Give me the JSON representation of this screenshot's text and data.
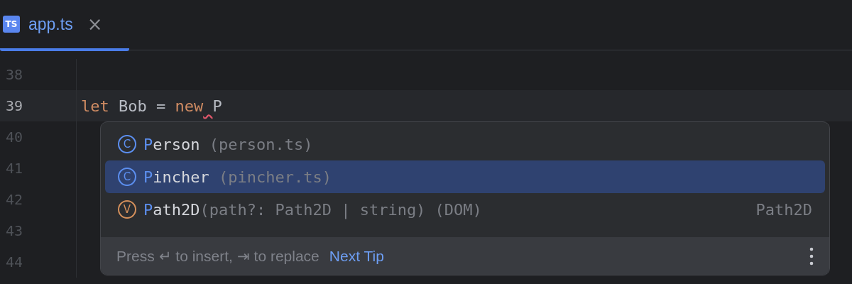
{
  "tabs": [
    {
      "label": "app.ts",
      "icon_text": "TS",
      "selected": true,
      "close": "×"
    }
  ],
  "editor": {
    "lines": [
      {
        "number": "38",
        "current": false
      },
      {
        "number": "39",
        "current": true,
        "tokens": [
          {
            "kind": "keyword",
            "text": "let"
          },
          {
            "kind": "plain",
            "text": " Bob = "
          },
          {
            "kind": "keyword",
            "text": "new"
          },
          {
            "kind": "plain",
            "text": " P",
            "error_lead": true
          }
        ]
      },
      {
        "number": "40",
        "current": false
      },
      {
        "number": "41",
        "current": false
      },
      {
        "number": "42",
        "current": false
      },
      {
        "number": "43",
        "current": false
      },
      {
        "number": "44",
        "current": false
      }
    ]
  },
  "completion": {
    "items": [
      {
        "kind": "class",
        "badge": "C",
        "match": "P",
        "rest": "erson",
        "detail": " (person.ts)",
        "selected": false
      },
      {
        "kind": "class",
        "badge": "C",
        "match": "P",
        "rest": "incher",
        "detail": " (pincher.ts)",
        "selected": true
      },
      {
        "kind": "variable",
        "badge": "V",
        "match": "P",
        "rest": "ath2D",
        "detail": "(path?: Path2D | string) (DOM)",
        "type": "Path2D",
        "selected": false
      }
    ],
    "footer": {
      "hint": "Press ↵ to insert, ⇥ to replace",
      "link": "Next Tip"
    }
  }
}
